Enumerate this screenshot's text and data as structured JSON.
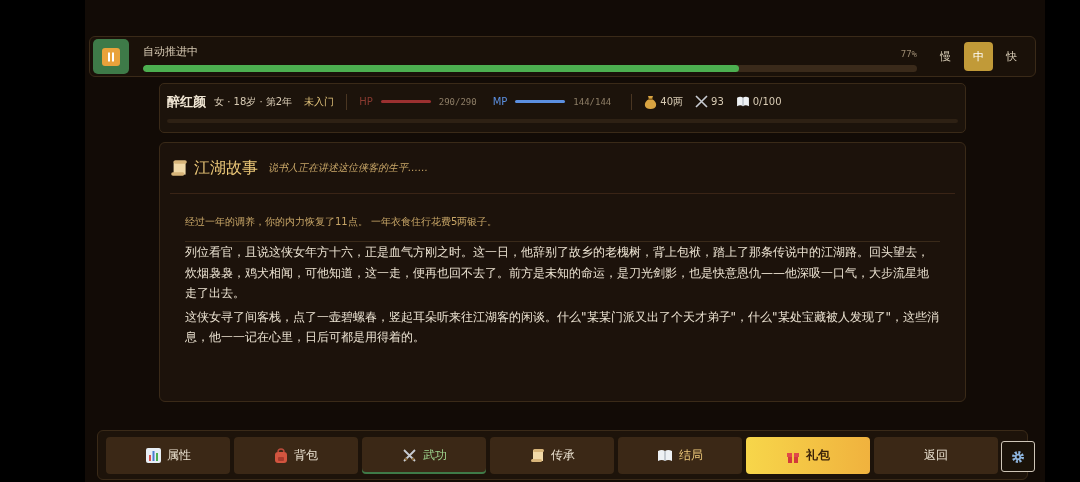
{
  "auto_bar": {
    "label": "自动推进中",
    "reading": "77%",
    "level": 0.77,
    "paused": false,
    "speeds": [
      {
        "label": "慢",
        "selected": false
      },
      {
        "label": "中",
        "selected": true
      },
      {
        "label": "快",
        "selected": false
      }
    ]
  },
  "character": {
    "name": "醉红颜",
    "info": "女 · 18岁 · 第2年",
    "sect": "未入门",
    "hp": {
      "label": "HP",
      "reading": "290/290"
    },
    "mp": {
      "label": "MP",
      "reading": "144/144"
    },
    "money": "40两",
    "attack": "93",
    "books": "0/100"
  },
  "story": {
    "title": "江湖故事",
    "subtitle": "说书人正在讲述这位侠客的生平……",
    "notice": "经过一年的调养，你的内力恢复了11点。 一年衣食住行花费5两银子。",
    "paragraphs": [
      "列位看官，且说这侠女年方十六，正是血气方刚之时。这一日，他辞别了故乡的老槐树，背上包袱，踏上了那条传说中的江湖路。回头望去，炊烟袅袅，鸡犬相闻，可他知道，这一走，便再也回不去了。前方是未知的命运，是刀光剑影，也是快意恩仇——他深吸一口气，大步流星地走了出去。",
      "这侠女寻了间客栈，点了一壶碧螺春，竖起耳朵听来往江湖客的闲谈。什么\"某某门派又出了个天才弟子\"，什么\"某处宝藏被人发现了\"，这些消息，他一一记在心里，日后可都是用得着的。"
    ]
  },
  "nav": [
    {
      "label": "属性",
      "kind": "stats",
      "selected": false
    },
    {
      "label": "背包",
      "kind": "bag",
      "selected": false
    },
    {
      "label": "武功",
      "kind": "martial",
      "selected": true
    },
    {
      "label": "传承",
      "kind": "scroll",
      "selected": false
    },
    {
      "label": "结局",
      "kind": "ending",
      "selected": false
    },
    {
      "label": "礼包",
      "kind": "gift",
      "selected": false
    },
    {
      "label": "返回",
      "kind": "back",
      "selected": false
    }
  ]
}
